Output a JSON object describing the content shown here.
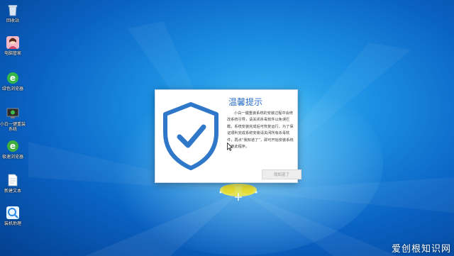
{
  "desktop": {
    "icons": [
      {
        "label": "回收站",
        "icon": "recycle-bin-icon"
      },
      {
        "label": "电脑管家",
        "icon": "app-avatar-icon"
      },
      {
        "label": "绿色浏览器",
        "icon": "ie-browser-icon"
      },
      {
        "label": "小白一键重装系统",
        "icon": "installer-icon"
      },
      {
        "label": "极速浏览器",
        "icon": "browser-icon"
      },
      {
        "label": "新建文本",
        "icon": "text-file-icon"
      },
      {
        "label": "装机助理",
        "icon": "setup-assistant-icon"
      }
    ]
  },
  "dialog": {
    "title": "温馨提示",
    "message": "小白一键重装系统的安装过程中会修改系统引导，请关闭杀毒软件以免误拦截，系统安装完成后可恢复运行，为了保证顺利完成系统安装请关闭所有杀毒软件，再点“我知道了”，即可开始安装系统使用此程序。",
    "close_label": "我知道了",
    "shield_icon": "shield-check-icon"
  },
  "watermark": "爱创根知识网",
  "colors": {
    "shield": "#2f77c9",
    "accent": "#2a6fc9",
    "desktop_bg": "#1b8fe2"
  }
}
